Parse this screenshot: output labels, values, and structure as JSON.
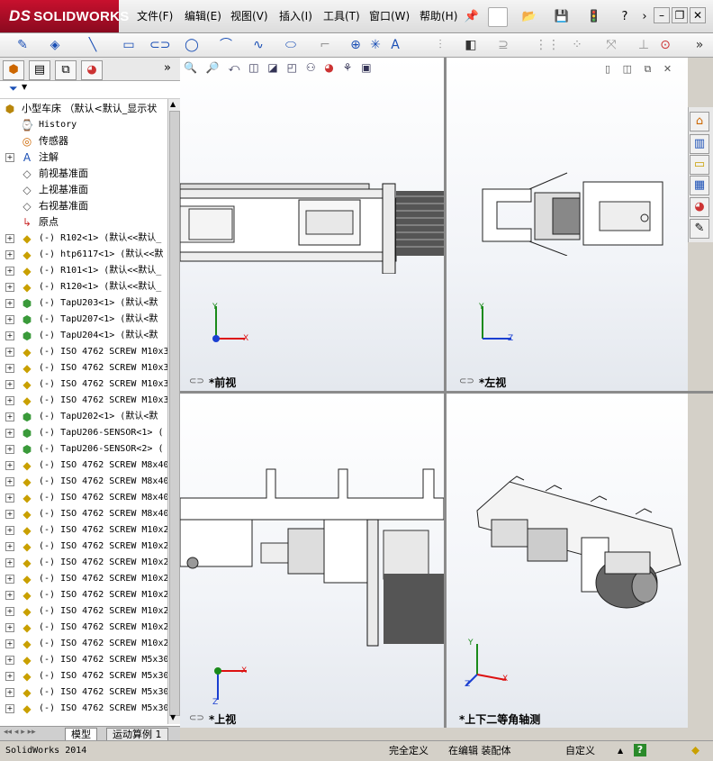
{
  "app": {
    "logo_text": "SOLIDWORKS",
    "logo_prefix": "DS"
  },
  "menu": [
    "文件(F)",
    "编辑(E)",
    "视图(V)",
    "插入(I)",
    "工具(T)",
    "窗口(W)",
    "帮助(H)"
  ],
  "filter_icon": "funnel-icon",
  "tree": {
    "root_label": "小型车床 （默认<默认_显示状",
    "items": [
      {
        "label": "History",
        "icon": "history-icon",
        "expand": false
      },
      {
        "label": "传感器",
        "icon": "sensor-icon",
        "expand": false
      },
      {
        "label": "注解",
        "icon": "annotation-icon",
        "expand": true
      },
      {
        "label": "前视基准面",
        "icon": "plane-icon",
        "expand": false
      },
      {
        "label": "上视基准面",
        "icon": "plane-icon",
        "expand": false
      },
      {
        "label": "右视基准面",
        "icon": "plane-icon",
        "expand": false
      },
      {
        "label": "原点",
        "icon": "origin-icon",
        "expand": false
      },
      {
        "label": "(-) R102<1> (默认<<默认_",
        "icon": "part-icon",
        "expand": true
      },
      {
        "label": "(-) htp6117<1> (默认<<默",
        "icon": "part-icon",
        "expand": true
      },
      {
        "label": "(-) R101<1> (默认<<默认_",
        "icon": "part-icon",
        "expand": true
      },
      {
        "label": "(-) R120<1> (默认<<默认_",
        "icon": "part-icon",
        "expand": true
      },
      {
        "label": "(-) TapU203<1> (默认<默",
        "icon": "assembly-icon",
        "expand": true
      },
      {
        "label": "(-) TapU207<1> (默认<默",
        "icon": "assembly-icon",
        "expand": true
      },
      {
        "label": "(-) TapU204<1> (默认<默",
        "icon": "assembly-icon",
        "expand": true
      },
      {
        "label": "(-) ISO 4762 SCREW M10x3",
        "icon": "part-icon",
        "expand": true
      },
      {
        "label": "(-) ISO 4762 SCREW M10x3",
        "icon": "part-icon",
        "expand": true
      },
      {
        "label": "(-) ISO 4762 SCREW M10x3",
        "icon": "part-icon",
        "expand": true
      },
      {
        "label": "(-) ISO 4762 SCREW M10x3",
        "icon": "part-icon",
        "expand": true
      },
      {
        "label": "(-) TapU202<1> (默认<默",
        "icon": "assembly-icon",
        "expand": true
      },
      {
        "label": "(-) TapU206-SENSOR<1> (",
        "icon": "assembly-icon",
        "expand": true
      },
      {
        "label": "(-) TapU206-SENSOR<2> (",
        "icon": "assembly-icon",
        "expand": true
      },
      {
        "label": "(-) ISO 4762 SCREW M8x40",
        "icon": "part-icon",
        "expand": true
      },
      {
        "label": "(-) ISO 4762 SCREW M8x40",
        "icon": "part-icon",
        "expand": true
      },
      {
        "label": "(-) ISO 4762 SCREW M8x40",
        "icon": "part-icon",
        "expand": true
      },
      {
        "label": "(-) ISO 4762 SCREW M8x40",
        "icon": "part-icon",
        "expand": true
      },
      {
        "label": "(-) ISO 4762 SCREW M10x2",
        "icon": "part-icon",
        "expand": true
      },
      {
        "label": "(-) ISO 4762 SCREW M10x2",
        "icon": "part-icon",
        "expand": true
      },
      {
        "label": "(-) ISO 4762 SCREW M10x2",
        "icon": "part-icon",
        "expand": true
      },
      {
        "label": "(-) ISO 4762 SCREW M10x2",
        "icon": "part-icon",
        "expand": true
      },
      {
        "label": "(-) ISO 4762 SCREW M10x2",
        "icon": "part-icon",
        "expand": true
      },
      {
        "label": "(-) ISO 4762 SCREW M10x2",
        "icon": "part-icon",
        "expand": true
      },
      {
        "label": "(-) ISO 4762 SCREW M10x2",
        "icon": "part-icon",
        "expand": true
      },
      {
        "label": "(-) ISO 4762 SCREW M10x2",
        "icon": "part-icon",
        "expand": true
      },
      {
        "label": "(-) ISO 4762 SCREW M5x30",
        "icon": "part-icon",
        "expand": true
      },
      {
        "label": "(-) ISO 4762 SCREW M5x30",
        "icon": "part-icon",
        "expand": true
      },
      {
        "label": "(-) ISO 4762 SCREW M5x30",
        "icon": "part-icon",
        "expand": true
      },
      {
        "label": "(-) ISO 4762 SCREW M5x30",
        "icon": "part-icon",
        "expand": true
      }
    ]
  },
  "bottom_tabs": [
    "模型",
    "运动算例 1"
  ],
  "viewports": {
    "front": "*前视",
    "left": "*左视",
    "top": "*上视",
    "iso": "*上下二等角轴测"
  },
  "axis": {
    "x": "X",
    "y": "Y",
    "z": "Z"
  },
  "status": {
    "app_version": "SolidWorks 2014",
    "definition": "完全定义",
    "editing": "在编辑 装配体",
    "units": "自定义",
    "help": "?"
  },
  "colors": {
    "logo_red": "#c8102e",
    "axis_x": "#d11",
    "axis_y": "#1a8a1a",
    "axis_z": "#1a3fd1"
  }
}
